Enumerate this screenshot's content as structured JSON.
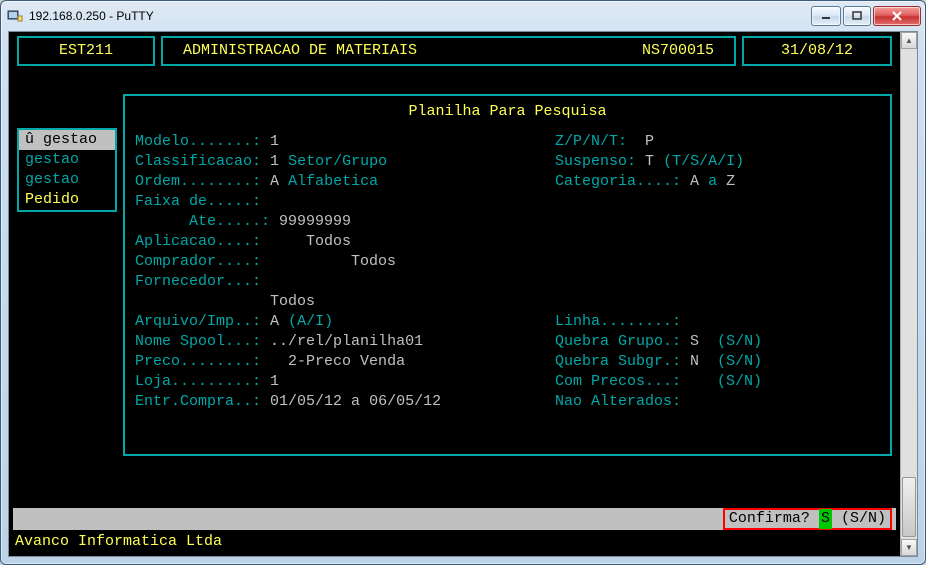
{
  "window": {
    "title": "192.168.0.250 - PuTTY"
  },
  "header": {
    "code": "EST211",
    "title": "ADMINISTRACAO DE MATERIAIS",
    "session": "NS700015",
    "date": "31/08/12"
  },
  "sidebar": {
    "items": [
      {
        "label": "û gestao",
        "hl": true
      },
      {
        "label": "gestao"
      },
      {
        "label": "gestao"
      },
      {
        "label": "Pedido",
        "yellow": true
      }
    ]
  },
  "panel": {
    "title": "Planilha Para Pesquisa",
    "modelo_lbl": "Modelo.......:",
    "modelo_val": "1",
    "zptn_lbl": "Z/P/N/T:",
    "zptn_val": "P",
    "class_lbl": "Classificacao:",
    "class_val": "1",
    "class_desc": "Setor/Grupo",
    "susp_lbl": "Suspenso:",
    "susp_val": "T",
    "susp_opts": "(T/S/A/I)",
    "ordem_lbl": "Ordem........:",
    "ordem_val": "A",
    "ordem_desc": "Alfabetica",
    "categ_lbl": "Categoria....:",
    "categ_from": "A",
    "categ_mid": "a",
    "categ_to": "Z",
    "faixa_lbl": "Faixa de.....:",
    "ate_lbl": "Ate.....:",
    "ate_val": "99999999",
    "aplic_lbl": "Aplicacao....:",
    "aplic_val": "Todos",
    "compr_lbl": "Comprador....:",
    "compr_val": "Todos",
    "forn_lbl": "Fornecedor...:",
    "forn_val": "Todos",
    "arq_lbl": "Arquivo/Imp..:",
    "arq_val": "A",
    "arq_opts": "(A/I)",
    "linha_lbl": "Linha........:",
    "spool_lbl": "Nome Spool...:",
    "spool_val": "../rel/planilha01",
    "qgrp_lbl": "Quebra Grupo.:",
    "qgrp_val": "S",
    "qgrp_opts": "(S/N)",
    "preco_lbl": "Preco........:",
    "preco_val": "2-Preco Venda",
    "qsub_lbl": "Quebra Subgr.:",
    "qsub_val": "N",
    "qsub_opts": "(S/N)",
    "loja_lbl": "Loja.........:",
    "loja_val": "1",
    "cpre_lbl": "Com Precos...:",
    "cpre_opts": "(S/N)",
    "entr_lbl": "Entr.Compra..:",
    "entr_val": "01/05/12 a 06/05/12",
    "nalt_lbl": "Nao Alterados:"
  },
  "prompt": {
    "label": "Confirma?",
    "value": "S",
    "opts": "(S/N)"
  },
  "footer": "Avanco Informatica Ltda"
}
